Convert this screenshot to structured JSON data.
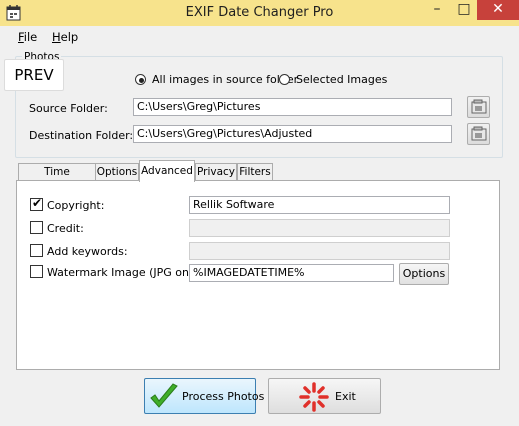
{
  "window": {
    "title": "EXIF Date Changer Pro",
    "minimize_glyph": "–",
    "maximize_glyph": "□",
    "close_glyph": "✕"
  },
  "menu": {
    "file_accel": "F",
    "file_rest": "ile",
    "help_accel": "H",
    "help_rest": "elp"
  },
  "photos": {
    "group_label": "Photos",
    "prev_label": "PREV",
    "radio_all": "All images in source folder",
    "radio_selected": "Selected Images",
    "radio_all_selected": true,
    "source_label": "Source Folder:",
    "source_value": "C:\\Users\\Greg\\Pictures",
    "destination_label": "Destination Folder:",
    "destination_value": "C:\\Users\\Greg\\Pictures\\Adjusted"
  },
  "tabs": {
    "items": [
      "Time Difference",
      "Options",
      "Advanced",
      "Privacy",
      "Filters"
    ],
    "active": "Advanced"
  },
  "advanced": {
    "copyright_label": "Copyright:",
    "copyright_checked": true,
    "copyright_value": "Rellik Software",
    "credit_label": "Credit:",
    "credit_checked": false,
    "credit_value": "",
    "keywords_label": "Add keywords:",
    "keywords_checked": false,
    "keywords_value": "",
    "watermark_label": "Watermark Image (JPG only):",
    "watermark_checked": false,
    "watermark_value": "%IMAGEDATETIME%",
    "options_button": "Options"
  },
  "actions": {
    "process_label": "Process Photos",
    "exit_label": "Exit"
  },
  "colors": {
    "titlebar": "#f7e38c",
    "close_button": "#c7413b",
    "check_green": "#3fae29",
    "exit_red": "#e0302a"
  }
}
